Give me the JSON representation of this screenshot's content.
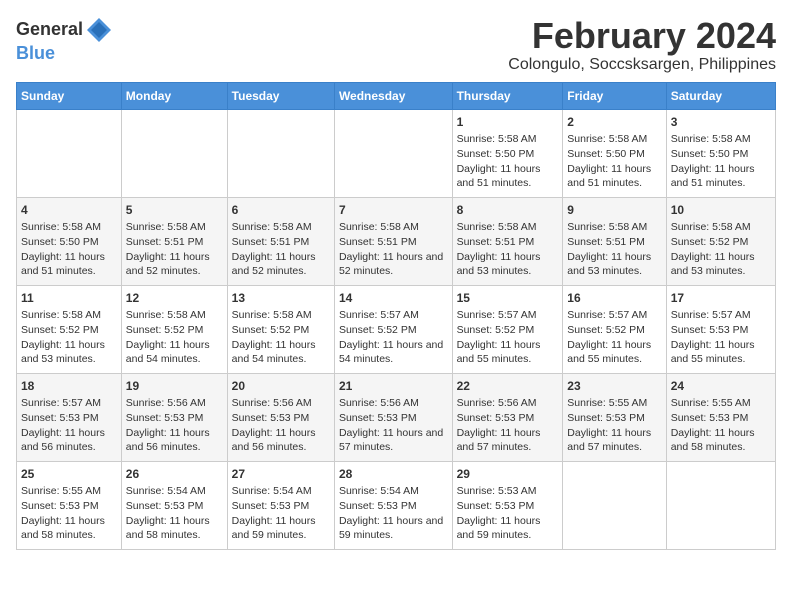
{
  "header": {
    "logo_line1": "General",
    "logo_line2": "Blue",
    "title": "February 2024",
    "subtitle": "Colongulo, Soccsksargen, Philippines"
  },
  "days_of_week": [
    "Sunday",
    "Monday",
    "Tuesday",
    "Wednesday",
    "Thursday",
    "Friday",
    "Saturday"
  ],
  "weeks": [
    [
      {
        "day": "",
        "sunrise": "",
        "sunset": "",
        "daylight": ""
      },
      {
        "day": "",
        "sunrise": "",
        "sunset": "",
        "daylight": ""
      },
      {
        "day": "",
        "sunrise": "",
        "sunset": "",
        "daylight": ""
      },
      {
        "day": "",
        "sunrise": "",
        "sunset": "",
        "daylight": ""
      },
      {
        "day": "1",
        "sunrise": "5:58 AM",
        "sunset": "5:50 PM",
        "daylight": "11 hours and 51 minutes."
      },
      {
        "day": "2",
        "sunrise": "5:58 AM",
        "sunset": "5:50 PM",
        "daylight": "11 hours and 51 minutes."
      },
      {
        "day": "3",
        "sunrise": "5:58 AM",
        "sunset": "5:50 PM",
        "daylight": "11 hours and 51 minutes."
      }
    ],
    [
      {
        "day": "4",
        "sunrise": "5:58 AM",
        "sunset": "5:50 PM",
        "daylight": "11 hours and 51 minutes."
      },
      {
        "day": "5",
        "sunrise": "5:58 AM",
        "sunset": "5:51 PM",
        "daylight": "11 hours and 52 minutes."
      },
      {
        "day": "6",
        "sunrise": "5:58 AM",
        "sunset": "5:51 PM",
        "daylight": "11 hours and 52 minutes."
      },
      {
        "day": "7",
        "sunrise": "5:58 AM",
        "sunset": "5:51 PM",
        "daylight": "11 hours and 52 minutes."
      },
      {
        "day": "8",
        "sunrise": "5:58 AM",
        "sunset": "5:51 PM",
        "daylight": "11 hours and 53 minutes."
      },
      {
        "day": "9",
        "sunrise": "5:58 AM",
        "sunset": "5:51 PM",
        "daylight": "11 hours and 53 minutes."
      },
      {
        "day": "10",
        "sunrise": "5:58 AM",
        "sunset": "5:52 PM",
        "daylight": "11 hours and 53 minutes."
      }
    ],
    [
      {
        "day": "11",
        "sunrise": "5:58 AM",
        "sunset": "5:52 PM",
        "daylight": "11 hours and 53 minutes."
      },
      {
        "day": "12",
        "sunrise": "5:58 AM",
        "sunset": "5:52 PM",
        "daylight": "11 hours and 54 minutes."
      },
      {
        "day": "13",
        "sunrise": "5:58 AM",
        "sunset": "5:52 PM",
        "daylight": "11 hours and 54 minutes."
      },
      {
        "day": "14",
        "sunrise": "5:57 AM",
        "sunset": "5:52 PM",
        "daylight": "11 hours and 54 minutes."
      },
      {
        "day": "15",
        "sunrise": "5:57 AM",
        "sunset": "5:52 PM",
        "daylight": "11 hours and 55 minutes."
      },
      {
        "day": "16",
        "sunrise": "5:57 AM",
        "sunset": "5:52 PM",
        "daylight": "11 hours and 55 minutes."
      },
      {
        "day": "17",
        "sunrise": "5:57 AM",
        "sunset": "5:53 PM",
        "daylight": "11 hours and 55 minutes."
      }
    ],
    [
      {
        "day": "18",
        "sunrise": "5:57 AM",
        "sunset": "5:53 PM",
        "daylight": "11 hours and 56 minutes."
      },
      {
        "day": "19",
        "sunrise": "5:56 AM",
        "sunset": "5:53 PM",
        "daylight": "11 hours and 56 minutes."
      },
      {
        "day": "20",
        "sunrise": "5:56 AM",
        "sunset": "5:53 PM",
        "daylight": "11 hours and 56 minutes."
      },
      {
        "day": "21",
        "sunrise": "5:56 AM",
        "sunset": "5:53 PM",
        "daylight": "11 hours and 57 minutes."
      },
      {
        "day": "22",
        "sunrise": "5:56 AM",
        "sunset": "5:53 PM",
        "daylight": "11 hours and 57 minutes."
      },
      {
        "day": "23",
        "sunrise": "5:55 AM",
        "sunset": "5:53 PM",
        "daylight": "11 hours and 57 minutes."
      },
      {
        "day": "24",
        "sunrise": "5:55 AM",
        "sunset": "5:53 PM",
        "daylight": "11 hours and 58 minutes."
      }
    ],
    [
      {
        "day": "25",
        "sunrise": "5:55 AM",
        "sunset": "5:53 PM",
        "daylight": "11 hours and 58 minutes."
      },
      {
        "day": "26",
        "sunrise": "5:54 AM",
        "sunset": "5:53 PM",
        "daylight": "11 hours and 58 minutes."
      },
      {
        "day": "27",
        "sunrise": "5:54 AM",
        "sunset": "5:53 PM",
        "daylight": "11 hours and 59 minutes."
      },
      {
        "day": "28",
        "sunrise": "5:54 AM",
        "sunset": "5:53 PM",
        "daylight": "11 hours and 59 minutes."
      },
      {
        "day": "29",
        "sunrise": "5:53 AM",
        "sunset": "5:53 PM",
        "daylight": "11 hours and 59 minutes."
      },
      {
        "day": "",
        "sunrise": "",
        "sunset": "",
        "daylight": ""
      },
      {
        "day": "",
        "sunrise": "",
        "sunset": "",
        "daylight": ""
      }
    ]
  ]
}
